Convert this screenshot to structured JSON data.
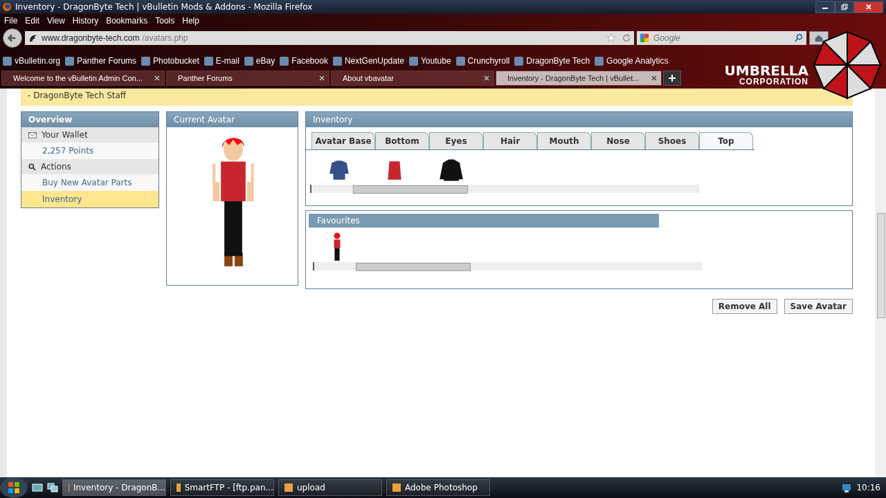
{
  "window": {
    "title": "Inventory - DragonByte Tech | vBulletin Mods & Addons - Mozilla Firefox"
  },
  "menu": [
    "File",
    "Edit",
    "View",
    "History",
    "Bookmarks",
    "Tools",
    "Help"
  ],
  "address": {
    "domain": "www.dragonbyte-tech.com",
    "path": "/avatars.php"
  },
  "search": {
    "placeholder": "Google"
  },
  "theme": {
    "line1": "UMBRELLA",
    "line2": "CORPORATION"
  },
  "bookmarks": [
    "vBulletin.org",
    "Panther Forums",
    "Photobucket",
    "E-mail",
    "eBay",
    "Facebook",
    "NextGenUpdate",
    "Youtube",
    "Crunchyroll",
    "DragonByte Tech",
    "Google Analytics"
  ],
  "browser_tabs": [
    {
      "label": "Welcome to the vBulletin Admin Con...",
      "selected": false
    },
    {
      "label": "Panther Forums",
      "selected": false
    },
    {
      "label": "About vbavatar",
      "selected": false
    },
    {
      "label": "Inventory - DragonByte Tech | vBullet...",
      "selected": true
    }
  ],
  "notice": {
    "signature": "- DragonByte Tech Staff"
  },
  "sidebar": {
    "title": "Overview",
    "items": [
      {
        "kind": "header",
        "label": "Your Wallet",
        "selected": false
      },
      {
        "kind": "link",
        "label": "2,257 Points",
        "selected": false
      },
      {
        "kind": "header",
        "label": "Actions",
        "selected": false
      },
      {
        "kind": "link",
        "label": "Buy New Avatar Parts",
        "selected": false
      },
      {
        "kind": "link",
        "label": "Inventory",
        "selected": true
      }
    ]
  },
  "current_avatar": {
    "title": "Current Avatar"
  },
  "inventory": {
    "title": "Inventory",
    "tabs": [
      {
        "label": "Avatar Base",
        "selected": false
      },
      {
        "label": "Bottom",
        "selected": false
      },
      {
        "label": "Eyes",
        "selected": false
      },
      {
        "label": "Hair",
        "selected": false
      },
      {
        "label": "Mouth",
        "selected": false
      },
      {
        "label": "Nose",
        "selected": false
      },
      {
        "label": "Shoes",
        "selected": false
      },
      {
        "label": "Top",
        "selected": true
      }
    ]
  },
  "favourites": {
    "title": "Favourites"
  },
  "buttons": [
    "Remove All",
    "Save Avatar"
  ],
  "taskbar": {
    "items": [
      {
        "label": "Inventory - DragonB...",
        "selected": true
      },
      {
        "label": "SmartFTP - [ftp.pan...",
        "selected": false
      },
      {
        "label": "upload",
        "selected": false
      },
      {
        "label": "Adobe Photoshop",
        "selected": false
      }
    ],
    "clock": "10:16"
  }
}
